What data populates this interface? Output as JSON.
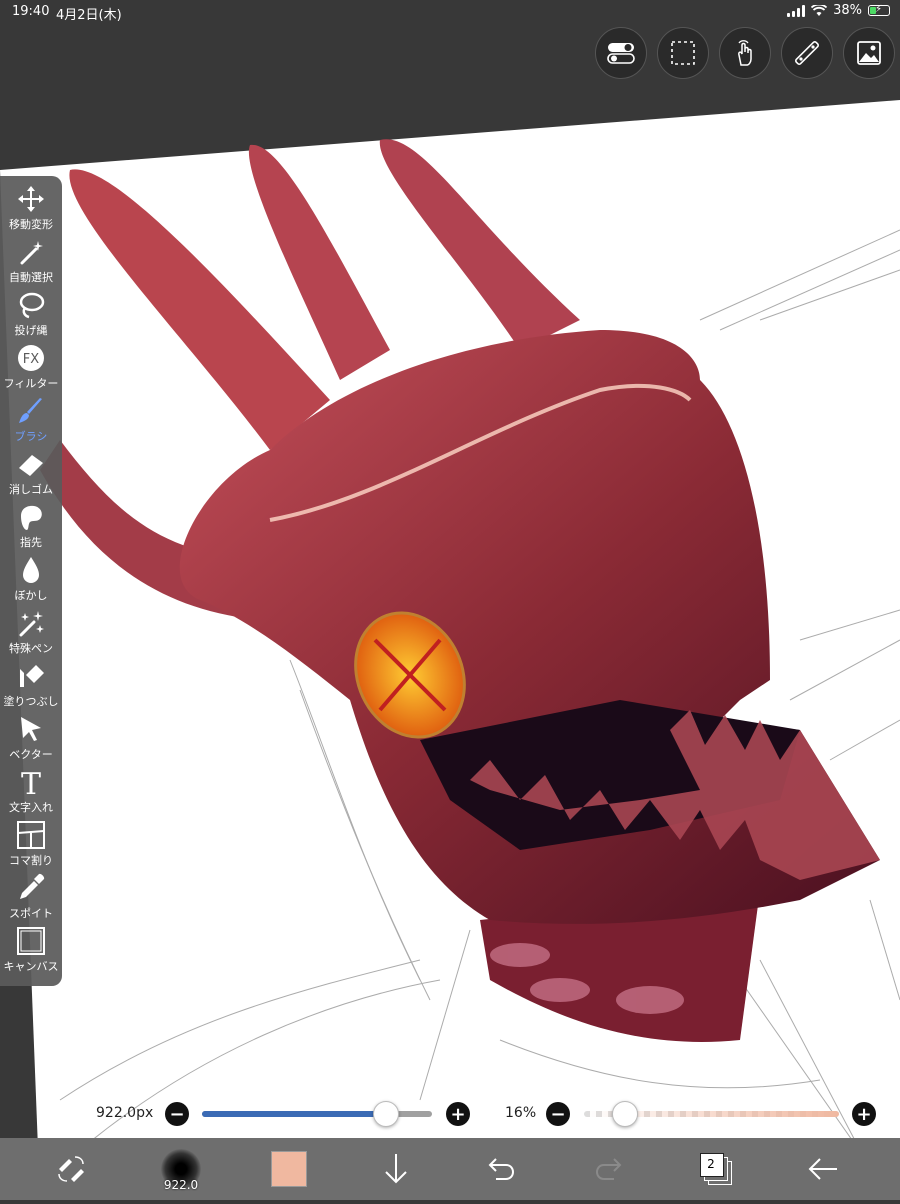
{
  "status": {
    "time": "19:40",
    "date": "4月2日(木)",
    "battery": "38%",
    "battery_level": 0.38
  },
  "top_toolbar": [
    {
      "name": "toggle-icon"
    },
    {
      "name": "selection-icon"
    },
    {
      "name": "gesture-icon"
    },
    {
      "name": "ruler-icon"
    },
    {
      "name": "material-icon"
    }
  ],
  "tools": [
    {
      "id": "move",
      "label": "移動変形",
      "icon": "move-icon"
    },
    {
      "id": "magic",
      "label": "自動選択",
      "icon": "magic-wand-icon"
    },
    {
      "id": "lasso",
      "label": "投げ縄",
      "icon": "lasso-icon"
    },
    {
      "id": "filter",
      "label": "フィルター",
      "icon": "fx-icon"
    },
    {
      "id": "brush",
      "label": "ブラシ",
      "icon": "brush-icon",
      "active": true
    },
    {
      "id": "eraser",
      "label": "消しゴム",
      "icon": "eraser-icon"
    },
    {
      "id": "finger",
      "label": "指先",
      "icon": "finger-icon"
    },
    {
      "id": "blur",
      "label": "ぼかし",
      "icon": "blur-icon"
    },
    {
      "id": "special",
      "label": "特殊ペン",
      "icon": "sparkle-icon"
    },
    {
      "id": "fill",
      "label": "塗りつぶし",
      "icon": "bucket-icon"
    },
    {
      "id": "vector",
      "label": "ベクター",
      "icon": "cursor-icon"
    },
    {
      "id": "text",
      "label": "文字入れ",
      "icon": "text-icon"
    },
    {
      "id": "panel",
      "label": "コマ割り",
      "icon": "panel-icon"
    },
    {
      "id": "eyedrop",
      "label": "スポイト",
      "icon": "eyedropper-icon"
    },
    {
      "id": "canvas",
      "label": "キャンバス",
      "icon": "canvas-icon"
    }
  ],
  "brush_size": {
    "value": "922.0px",
    "level": 0.8
  },
  "opacity": {
    "value": "16%",
    "level": 0.16
  },
  "bottom_bar": {
    "brush_size_label": "922.0",
    "layer_count": "2"
  },
  "colors": {
    "accent": "#3b6bb5",
    "current_color": "#f0b8a0"
  }
}
